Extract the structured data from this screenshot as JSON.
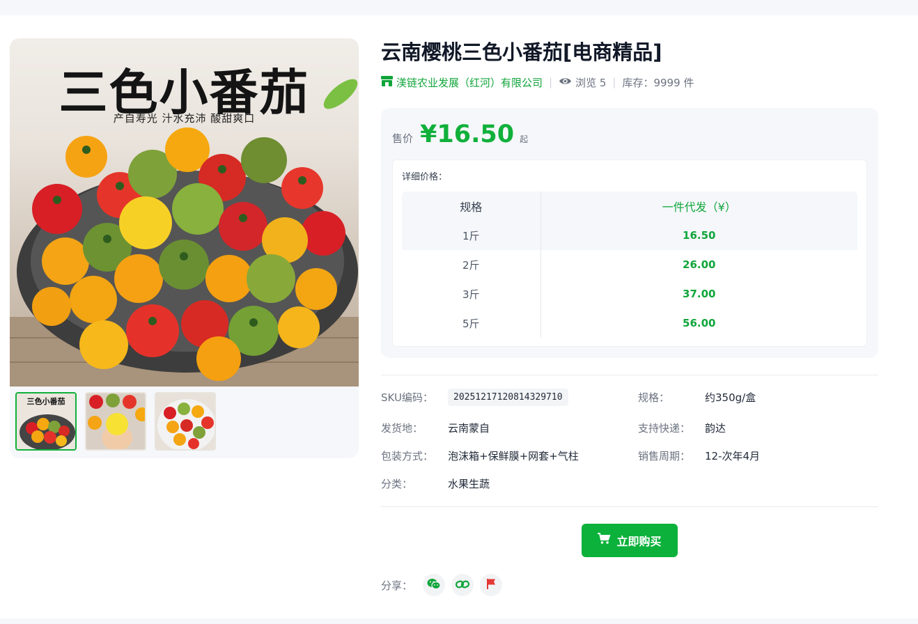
{
  "gallery": {
    "image_title": "三色小番茄",
    "image_subtitle": "产自寿光 汁水充沛 酸甜爽口",
    "thumb_caption": "三色小番茄",
    "thumbnails": [
      "tomato-bowl-main",
      "tomato-held-in-hand",
      "tomato-bowl-top-view"
    ],
    "active_thumb": 0
  },
  "product": {
    "title": "云南樱桃三色小番茄[电商精品]",
    "company": "渼链农业发展（红河）有限公司",
    "views_label": "浏览 5",
    "stock_label": "库存：9999 件"
  },
  "price": {
    "label": "售价",
    "value": "¥16.50",
    "suffix": "起",
    "detail_label": "详细价格：",
    "table": {
      "headers": [
        "规格",
        "一件代发（¥）"
      ],
      "rows": [
        {
          "spec": "1斤",
          "price": "16.50"
        },
        {
          "spec": "2斤",
          "price": "26.00"
        },
        {
          "spec": "3斤",
          "price": "37.00"
        },
        {
          "spec": "5斤",
          "price": "56.00"
        }
      ]
    }
  },
  "specs": {
    "sku_label": "SKU编码：",
    "sku_value": "20251217120814329710",
    "spec_label": "规格：",
    "spec_value": "约350g/盒",
    "origin_label": "发货地：",
    "origin_value": "云南蒙自",
    "express_label": "支持快递：",
    "express_value": "韵达",
    "packing_label": "包装方式：",
    "packing_value": "泡沫箱+保鲜膜+网套+气柱",
    "season_label": "销售周期：",
    "season_value": "12-次年4月",
    "category_label": "分类：",
    "category_value": "水果生蔬"
  },
  "actions": {
    "buy_label": "立即购买",
    "share_label": "分享："
  },
  "colors": {
    "accent": "#0bb13b",
    "share_wechat": "#10a53a",
    "share_link": "#10a53a",
    "share_report": "#e53935"
  },
  "icons": {
    "company": "store-icon",
    "views": "eye-icon",
    "buy": "cart-icon",
    "share": [
      "wechat-icon",
      "link-icon",
      "flag-icon"
    ]
  }
}
